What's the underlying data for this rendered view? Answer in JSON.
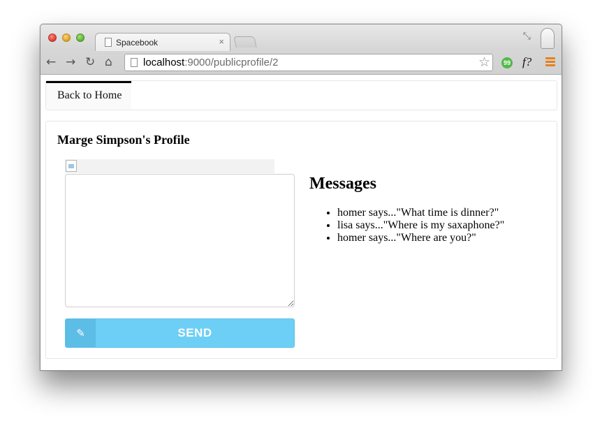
{
  "browser": {
    "tab_title": "Spacebook",
    "tab_close": "×",
    "url_host": "localhost",
    "url_path": ":9000/publicprofile/2",
    "ext_f_label": "f?",
    "ext_hangouts_label": "99"
  },
  "nav": {
    "home_label": "Back to Home"
  },
  "profile": {
    "title": "Marge Simpson's Profile",
    "message_placeholder": "",
    "send_label": "SEND",
    "send_icon": "edit-icon"
  },
  "messages": {
    "title": "Messages",
    "items": [
      {
        "text": "homer says...\"What time is dinner?\""
      },
      {
        "text": "lisa says...\"Where is my saxaphone?\""
      },
      {
        "text": "homer says...\"Where are you?\""
      }
    ]
  },
  "colors": {
    "send_button": "#6dcff5",
    "send_icon_bg": "#5cbde6",
    "nav_active_border": "#000000"
  }
}
